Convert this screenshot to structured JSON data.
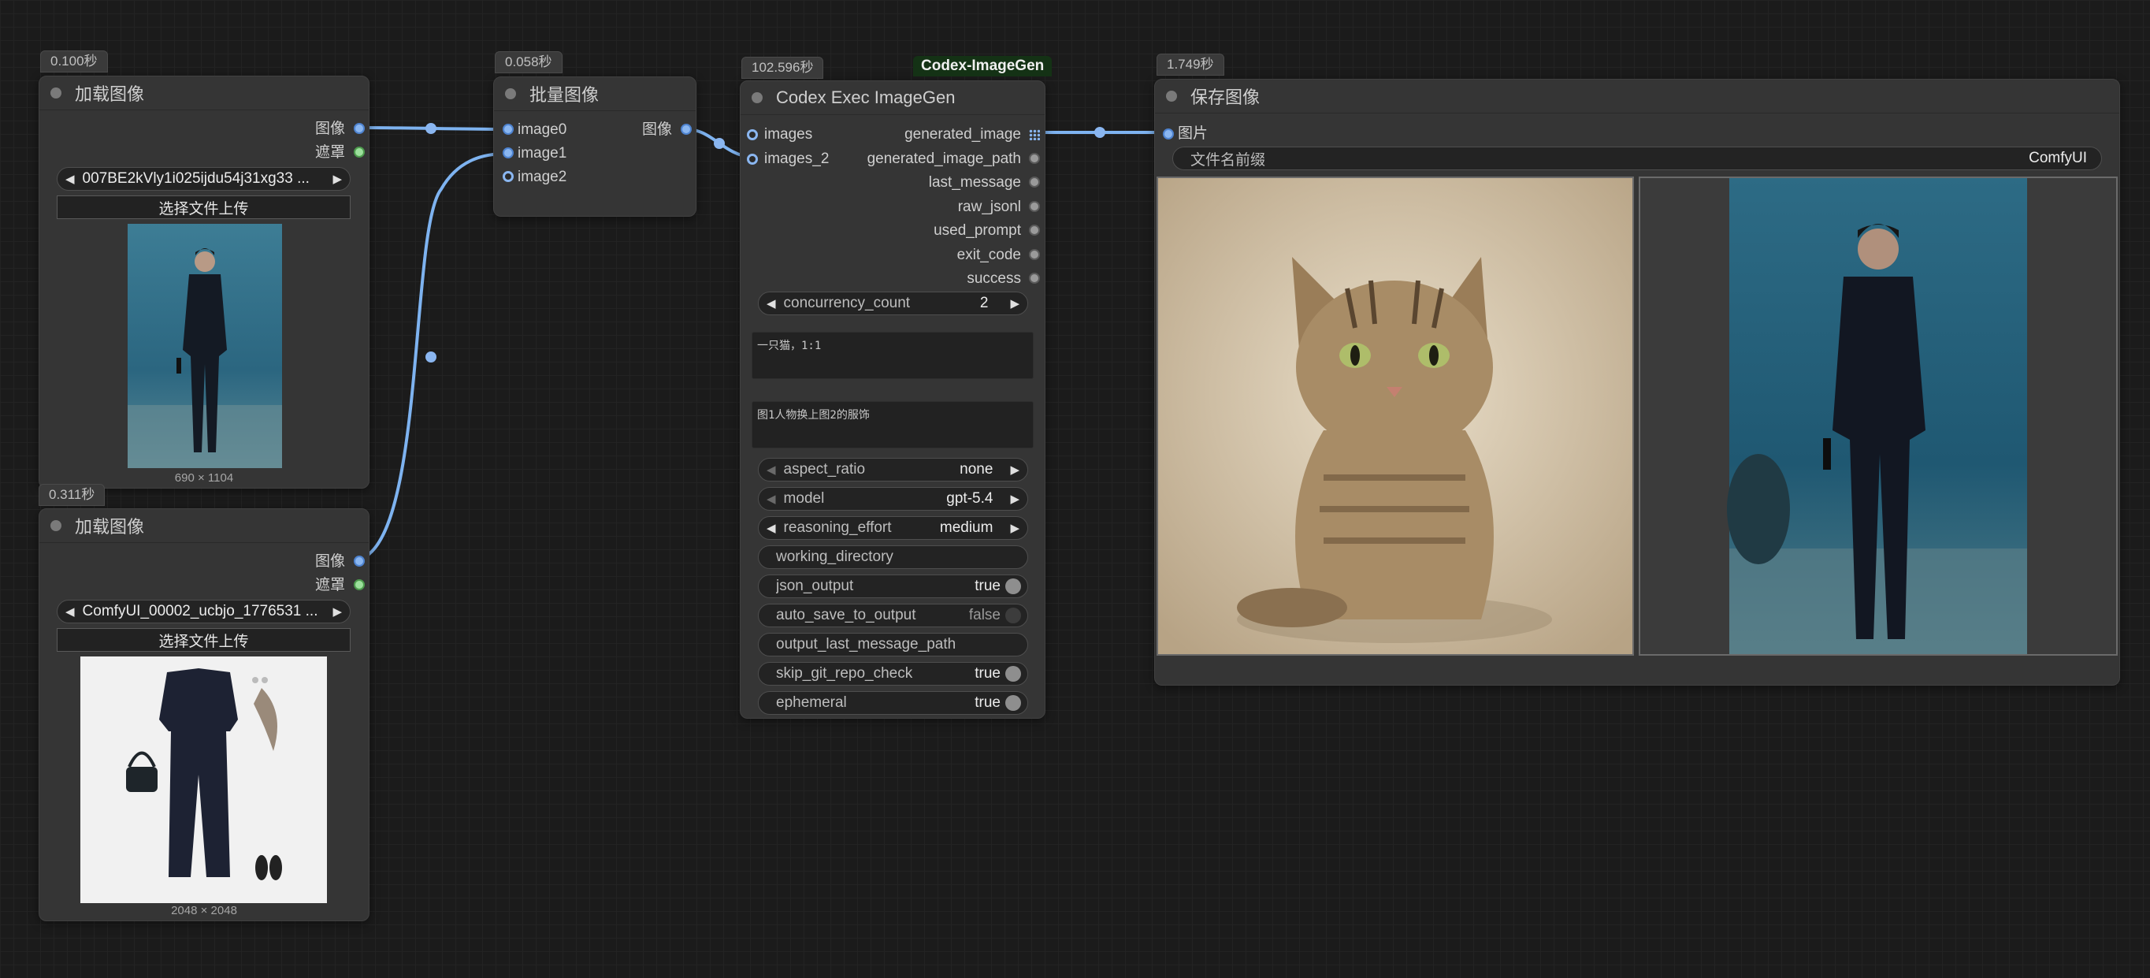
{
  "nodes": {
    "load1": {
      "time": "0.100秒",
      "title": "加载图像",
      "out_image": "图像",
      "out_mask": "遮罩",
      "file": "007BE2kVly1i025ijdu54j31xg33 ...",
      "upload": "选择文件上传",
      "dims": "690 × 1104"
    },
    "load2": {
      "time": "0.311秒",
      "title": "加载图像",
      "out_image": "图像",
      "out_mask": "遮罩",
      "file": "ComfyUI_00002_ucbjo_1776531 ...",
      "upload": "选择文件上传",
      "dims": "2048 × 2048"
    },
    "batch": {
      "time": "0.058秒",
      "title": "批量图像",
      "inputs": [
        "image0",
        "image1",
        "image2"
      ],
      "output": "图像"
    },
    "codex": {
      "time": "102.596秒",
      "tag": "Codex-ImageGen",
      "title": "Codex Exec ImageGen",
      "inputs": [
        "images",
        "images_2"
      ],
      "outputs": [
        "generated_image",
        "generated_image_path",
        "last_message",
        "raw_jsonl",
        "used_prompt",
        "exit_code",
        "success"
      ],
      "concurrency": {
        "label": "concurrency_count",
        "value": "2"
      },
      "prompt1": "一只猫，1:1",
      "prompt2": "图1人物换上图2的服饰",
      "aspect_ratio": {
        "label": "aspect_ratio",
        "value": "none"
      },
      "model": {
        "label": "model",
        "value": "gpt-5.4"
      },
      "reasoning": {
        "label": "reasoning_effort",
        "value": "medium"
      },
      "working_directory": {
        "label": "working_directory"
      },
      "json_output": {
        "label": "json_output",
        "value": "true"
      },
      "auto_save": {
        "label": "auto_save_to_output",
        "value": "false"
      },
      "output_path": {
        "label": "output_last_message_path"
      },
      "skip_git": {
        "label": "skip_git_repo_check",
        "value": "true"
      },
      "ephemeral": {
        "label": "ephemeral",
        "value": "true"
      }
    },
    "save": {
      "time": "1.749秒",
      "title": "保存图像",
      "input": "图片",
      "prefix_label": "文件名前缀",
      "prefix_value": "ComfyUI"
    }
  },
  "colors": {
    "wire": "#7eb3f0",
    "canvas": "#1b1b1b",
    "node": "#353535",
    "tag_bg": "#143215"
  }
}
